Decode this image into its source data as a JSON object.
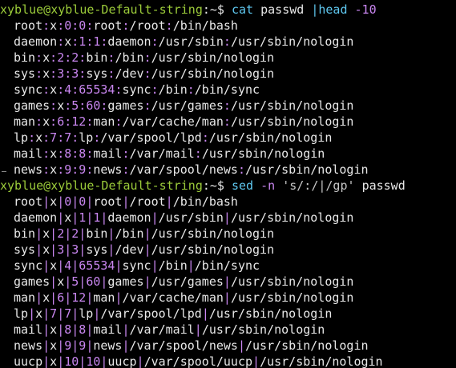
{
  "colors": {
    "background": "#000000",
    "prompt": "#9ccc3a",
    "text": "#e8e8e8",
    "command": "#5fc8f0",
    "separator": "#c986f0"
  },
  "prompt": {
    "user_host": "xyblue@xyblue-Default-string",
    "colon": ":",
    "path": "~$"
  },
  "commands": [
    {
      "command": "cat",
      "args": [
        {
          "type": "arg",
          "text": "passwd"
        },
        {
          "type": "cmd",
          "text": "|head"
        },
        {
          "type": "flag",
          "text": "-10"
        }
      ]
    },
    {
      "command": "sed",
      "args": [
        {
          "type": "flag",
          "text": "-n"
        },
        {
          "type": "str",
          "text": "'s/:/|/gp'"
        },
        {
          "type": "arg",
          "text": "passwd"
        }
      ]
    }
  ],
  "output_colon": [
    [
      "root",
      "x",
      "0",
      "0",
      "root",
      "/root",
      "/bin/bash"
    ],
    [
      "daemon",
      "x",
      "1",
      "1",
      "daemon",
      "/usr/sbin",
      "/usr/sbin/nologin"
    ],
    [
      "bin",
      "x",
      "2",
      "2",
      "bin",
      "/bin",
      "/usr/sbin/nologin"
    ],
    [
      "sys",
      "x",
      "3",
      "3",
      "sys",
      "/dev",
      "/usr/sbin/nologin"
    ],
    [
      "sync",
      "x",
      "4",
      "65534",
      "sync",
      "/bin",
      "/bin/sync"
    ],
    [
      "games",
      "x",
      "5",
      "60",
      "games",
      "/usr/games",
      "/usr/sbin/nologin"
    ],
    [
      "man",
      "x",
      "6",
      "12",
      "man",
      "/var/cache/man",
      "/usr/sbin/nologin"
    ],
    [
      "lp",
      "x",
      "7",
      "7",
      "lp",
      "/var/spool/lpd",
      "/usr/sbin/nologin"
    ],
    [
      "mail",
      "x",
      "8",
      "8",
      "mail",
      "/var/mail",
      "/usr/sbin/nologin"
    ],
    [
      "news",
      "x",
      "9",
      "9",
      "news",
      "/var/spool/news",
      "/usr/sbin/nologin"
    ]
  ],
  "output_pipe": [
    [
      "root",
      "x",
      "0",
      "0",
      "root",
      "/root",
      "/bin/bash"
    ],
    [
      "daemon",
      "x",
      "1",
      "1",
      "daemon",
      "/usr/sbin",
      "/usr/sbin/nologin"
    ],
    [
      "bin",
      "x",
      "2",
      "2",
      "bin",
      "/bin",
      "/usr/sbin/nologin"
    ],
    [
      "sys",
      "x",
      "3",
      "3",
      "sys",
      "/dev",
      "/usr/sbin/nologin"
    ],
    [
      "sync",
      "x",
      "4",
      "65534",
      "sync",
      "/bin",
      "/bin/sync"
    ],
    [
      "games",
      "x",
      "5",
      "60",
      "games",
      "/usr/games",
      "/usr/sbin/nologin"
    ],
    [
      "man",
      "x",
      "6",
      "12",
      "man",
      "/var/cache/man",
      "/usr/sbin/nologin"
    ],
    [
      "lp",
      "x",
      "7",
      "7",
      "lp",
      "/var/spool/lpd",
      "/usr/sbin/nologin"
    ],
    [
      "mail",
      "x",
      "8",
      "8",
      "mail",
      "/var/mail",
      "/usr/sbin/nologin"
    ],
    [
      "news",
      "x",
      "9",
      "9",
      "news",
      "/var/spool/news",
      "/usr/sbin/nologin"
    ],
    [
      "uucp",
      "x",
      "10",
      "10",
      "uucp",
      "/var/spool/uucp",
      "/usr/sbin/nologin"
    ]
  ]
}
